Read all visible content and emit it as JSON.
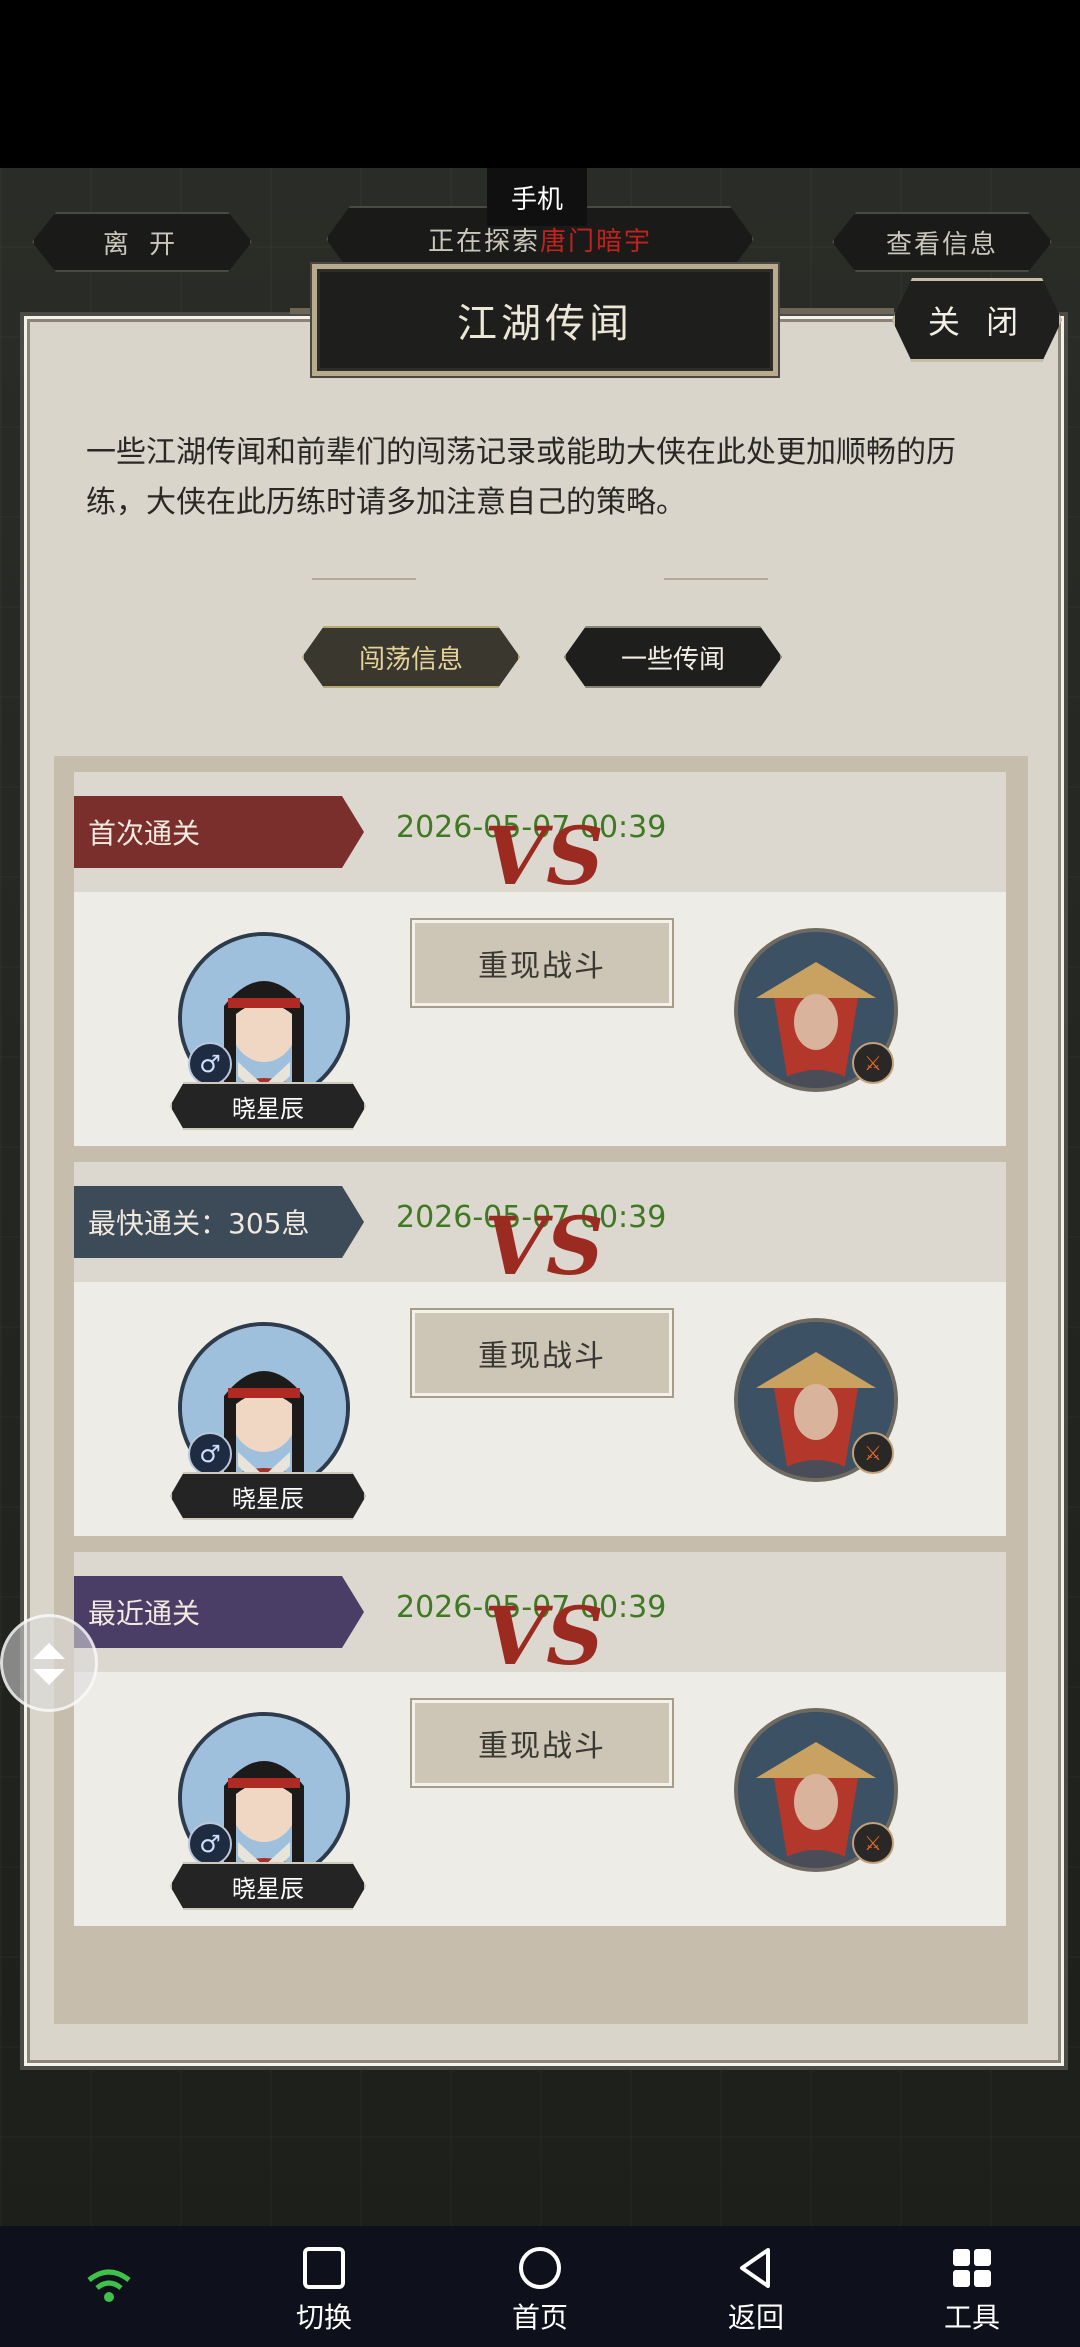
{
  "top_bar": {
    "leave_label": "离 开",
    "exploring_label": "正在探索",
    "exploring_target": "唐门暗宇",
    "view_info_label": "查看信息",
    "phone_tooltip": "手机"
  },
  "panel": {
    "title": "江湖传闻",
    "close_label": "关 闭",
    "description": "一些江湖传闻和前辈们的闯荡记录或能助大侠在此处更加顺畅的历练，大侠在此历练时请多加注意自己的策略。",
    "tabs": [
      {
        "label": "闯荡信息",
        "active": true
      },
      {
        "label": "一些传闻",
        "active": false
      }
    ]
  },
  "records": [
    {
      "label": "首次通关",
      "color": "#7a2f2c",
      "date": "2026-05-07 00:39",
      "player_name": "晓星辰",
      "replay_label": "重现战斗",
      "vs": "VS",
      "gender": "♂"
    },
    {
      "label": "最快通关：305息",
      "color": "#3d4a57",
      "date": "2026-05-07 00:39",
      "player_name": "晓星辰",
      "replay_label": "重现战斗",
      "vs": "VS",
      "gender": "♂"
    },
    {
      "label": "最近通关",
      "color": "#4b3e66",
      "date": "2026-05-07 00:39",
      "player_name": "晓星辰",
      "replay_label": "重现战斗",
      "vs": "VS",
      "gender": "♂"
    }
  ],
  "bottom_nav": {
    "items": [
      {
        "label": "切换",
        "icon": "square-icon"
      },
      {
        "label": "首页",
        "icon": "circle-icon"
      },
      {
        "label": "返回",
        "icon": "triangle-back-icon"
      },
      {
        "label": "工具",
        "icon": "grid-icon"
      }
    ],
    "wifi_icon": "wifi-icon",
    "wifi_color": "#3ec24a"
  }
}
